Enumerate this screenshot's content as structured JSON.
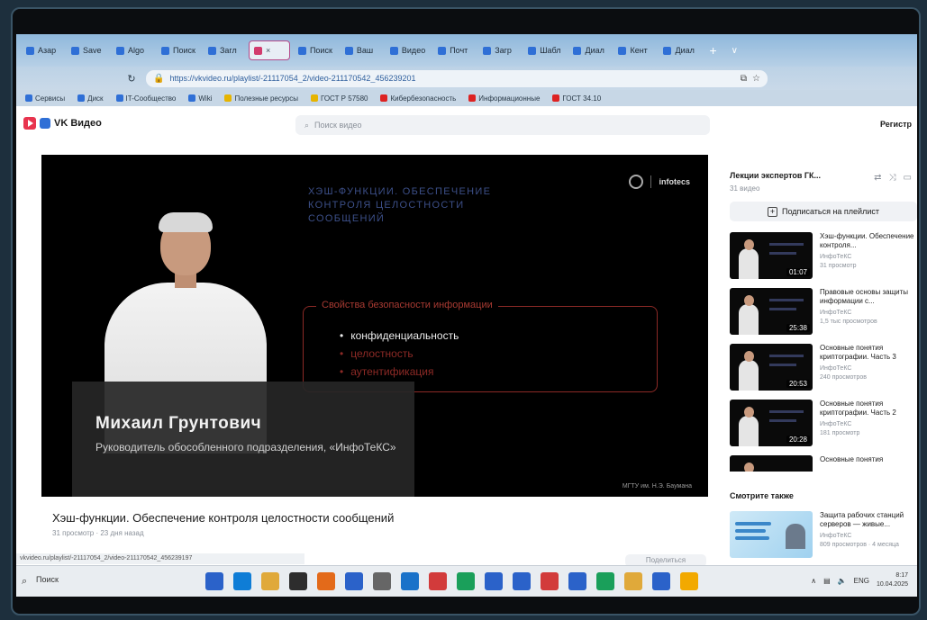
{
  "browser": {
    "tabs": [
      {
        "label": "Азар"
      },
      {
        "label": "Save"
      },
      {
        "label": "Algo"
      },
      {
        "label": "Поиск"
      },
      {
        "label": "Загл"
      },
      {
        "label": "×",
        "active": true
      },
      {
        "label": "Поиск"
      },
      {
        "label": "Ваш"
      },
      {
        "label": "Видео"
      },
      {
        "label": "Почт"
      },
      {
        "label": "Загр"
      },
      {
        "label": "Шабл"
      },
      {
        "label": "Диал"
      },
      {
        "label": "Кент"
      },
      {
        "label": "Диал"
      }
    ],
    "url": "https://vkvideo.ru/playlist/-21117054_2/video-211170542_456239201",
    "bookmarks": [
      {
        "label": "Сервисы"
      },
      {
        "label": "Диск"
      },
      {
        "label": "IT-Сообщество"
      },
      {
        "label": "Wiki"
      },
      {
        "label": "Полезные ресурсы"
      },
      {
        "label": "ГОСТ Р 57580"
      },
      {
        "label": "Кибербезопасность"
      },
      {
        "label": "Информационные"
      },
      {
        "label": "ГОСТ 34.10"
      }
    ]
  },
  "vk": {
    "logo_text": "VK Видео",
    "search_placeholder": "Поиск видео",
    "register_label": "Регистр"
  },
  "video": {
    "slide_title": "Хэш-функции. Обеспечение контроля целостности сообщений",
    "slide_brand": "infotecs",
    "properties_title": "Свойства безопасности информации",
    "properties": [
      {
        "label": "конфиденциальность",
        "highlighted": true
      },
      {
        "label": "целостность",
        "highlighted": false
      },
      {
        "label": "аутентификация",
        "highlighted": false
      }
    ],
    "speaker_name": "Михаил Грунтович",
    "speaker_role": "Руководитель обособленного подразделения, «ИнфоТеКС»",
    "credit": "МГТУ им. Н.Э. Баумана",
    "title": "Хэш-функции. Обеспечение контроля целостности сообщений",
    "meta": "31 просмотр · 23 дня назад"
  },
  "playlist": {
    "name": "Лекции экспертов ГК...",
    "count": "31 видео",
    "subscribe_label": "Подписаться на плейлист",
    "items": [
      {
        "title": "Хэш-функции. Обеспечение контроля...",
        "author": "ИнфоТеКС",
        "views": "31 просмотр",
        "duration": "01:07"
      },
      {
        "title": "Правовые основы защиты информации с...",
        "author": "ИнфоТеКС",
        "views": "1,5 тыс просмотров",
        "duration": "25:38"
      },
      {
        "title": "Основные понятия криптографии. Часть 3",
        "author": "ИнфоТеКС",
        "views": "240 просмотров",
        "duration": "20:53"
      },
      {
        "title": "Основные понятия криптографии. Часть 2",
        "author": "ИнфоТеКС",
        "views": "181 просмотр",
        "duration": "20:28"
      }
    ],
    "partial_item_title": "Основные понятия"
  },
  "recommended": {
    "heading": "Смотрите также",
    "items": [
      {
        "title": "Защита рабочих станций серверов — живые...",
        "author": "ИнфоТеКС",
        "views": "809 просмотров · 4 месяца"
      }
    ]
  },
  "statusbar": {
    "text": "vkvideo.ru/playlist/-21117054_2/video-211170542_456239197",
    "share_label": "Поделиться"
  },
  "taskbar": {
    "search_label": "Поиск",
    "tray_lang": "ENG",
    "time": "8:17",
    "date": "10.04.2025",
    "app_colors": [
      "#2b62c9",
      "#0f7dd6",
      "#e0a93a",
      "#2d2d2d",
      "#e36a1a",
      "#2b62c9",
      "#666666",
      "#1a72c9",
      "#d23b3b",
      "#1a9f5a",
      "#2b62c9",
      "#2b62c9",
      "#d23b3b",
      "#2b62c9",
      "#1a9f5a",
      "#e0a93a",
      "#2b62c9",
      "#f2a900"
    ]
  }
}
